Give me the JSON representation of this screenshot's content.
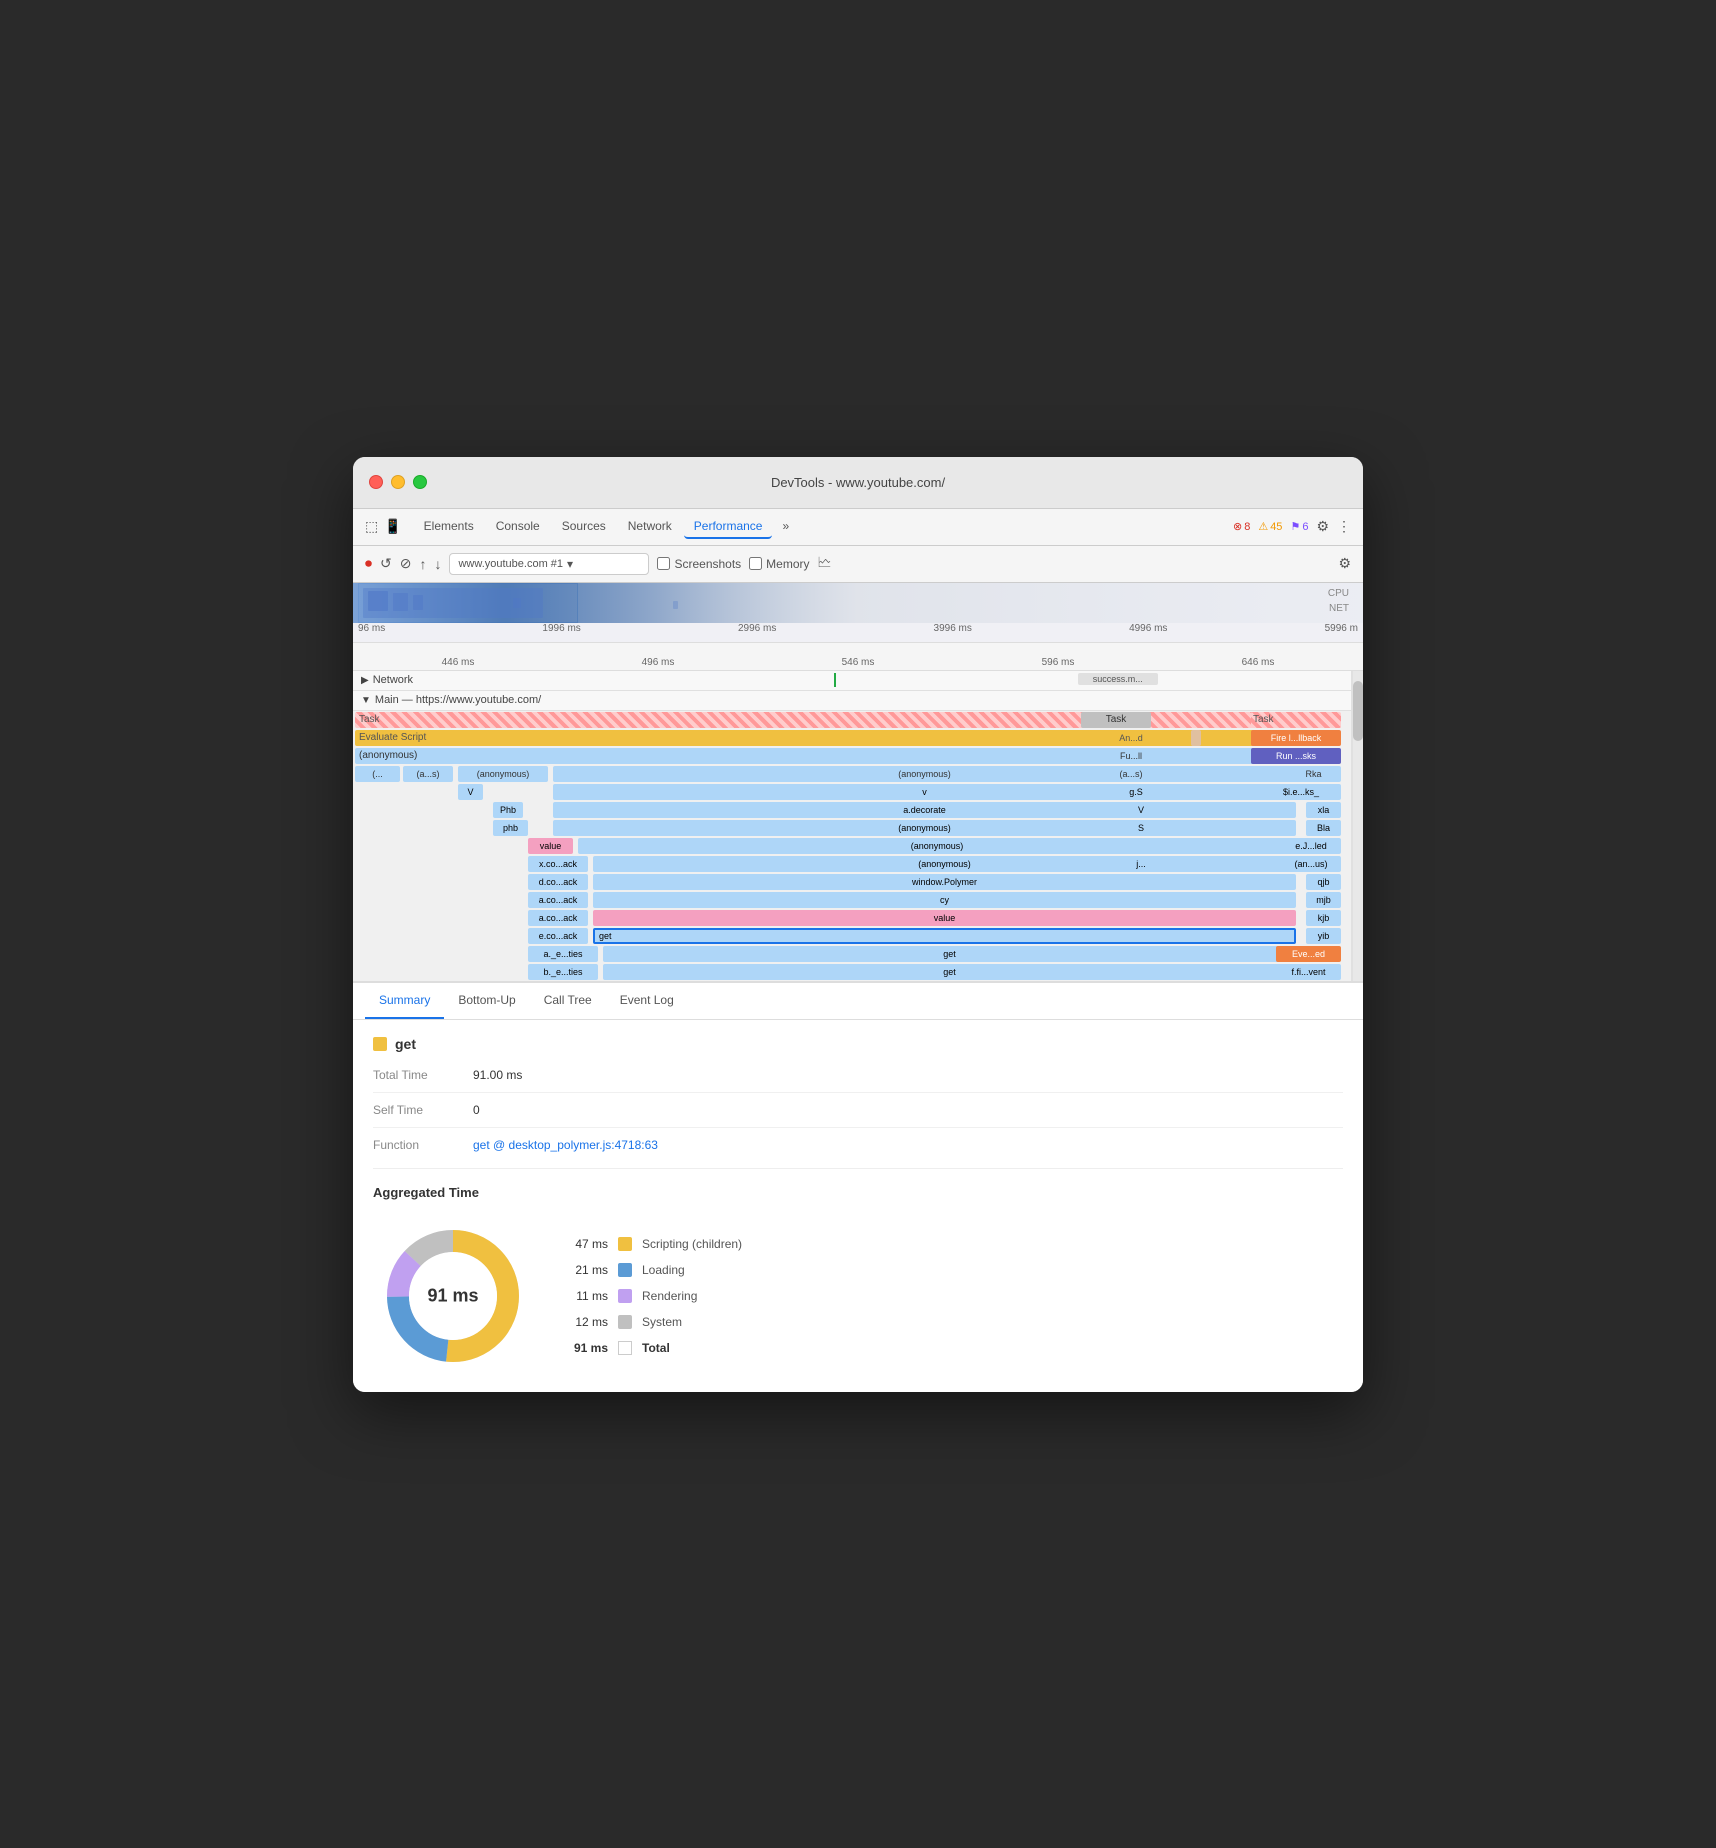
{
  "window": {
    "title": "DevTools - www.youtube.com/"
  },
  "titlebar": {
    "title": "DevTools - www.youtube.com/"
  },
  "tabs": {
    "items": [
      "Elements",
      "Console",
      "Sources",
      "Network",
      "Performance",
      "»"
    ],
    "active": "Performance"
  },
  "badges": {
    "errors": "8",
    "warnings": "45",
    "purple": "6"
  },
  "toolbar2": {
    "url": "www.youtube.com #1",
    "screenshots_label": "Screenshots",
    "memory_label": "Memory"
  },
  "minimap": {
    "labels": [
      "96 ms",
      "1996 ms",
      "2996 ms",
      "3996 ms",
      "4996 ms",
      "5996 m"
    ]
  },
  "timeline": {
    "labels": [
      "446 ms",
      "496 ms",
      "546 ms",
      "596 ms",
      "646 ms"
    ],
    "network_label": "Network",
    "main_label": "Main — https://www.youtube.com/",
    "success_badge": "success.m..."
  },
  "flamechart": {
    "rows": [
      {
        "label": "Task",
        "right_labels": [
          "Task",
          "Task"
        ],
        "type": "task"
      },
      {
        "label": "Evaluate Script",
        "right_labels": [
          "An...d",
          "Fire l...llback"
        ],
        "type": "evaluate"
      },
      {
        "label": "(anonymous)",
        "right_labels": [
          "Fu...ll",
          "Run ...sks"
        ],
        "type": "anonymous"
      },
      {
        "label": "(...",
        "sub": "(a...s)",
        "sub2": "(anonymous)",
        "sub3": "(anonymous)",
        "right": "(a...s)",
        "rr": "Rka"
      },
      {
        "label": "V",
        "sub": "v",
        "right": "g.S",
        "rr": "$i.e...ks_"
      },
      {
        "label": "Phb",
        "sub": "a.decorate",
        "right": "V",
        "rr": "xla"
      },
      {
        "label": "phb",
        "sub": "(anonymous)",
        "right": "S",
        "rr": "Bla"
      },
      {
        "label": "value",
        "sub": "(anonymous)",
        "rr": "e.J...led"
      },
      {
        "label": "x.co...ack",
        "sub": "(anonymous)",
        "right": "j...",
        "rr": "(an...us)"
      },
      {
        "label": "d.co...ack",
        "sub": "window.Polymer",
        "rr": "qjb"
      },
      {
        "label": "a.co...ack",
        "sub": "cy",
        "rr": "mjb"
      },
      {
        "label": "a.co...ack",
        "sub": "value",
        "rr": "kjb"
      },
      {
        "label": "e.co...ack",
        "sub": "get",
        "rr": "yib",
        "selected": true
      },
      {
        "label": "a._e...ties",
        "sub": "get",
        "rr": "Eve...ed"
      },
      {
        "label": "b._e...ties",
        "sub": "get",
        "rr": "f.fi...vent"
      }
    ]
  },
  "summary": {
    "tabs": [
      "Summary",
      "Bottom-Up",
      "Call Tree",
      "Event Log"
    ],
    "active_tab": "Summary",
    "function_name": "get",
    "total_time": "91.00 ms",
    "self_time": "0",
    "function_link": "get @ desktop_polymer.js:4718:63",
    "agg_title": "Aggregated Time",
    "donut_label": "91 ms",
    "legend": [
      {
        "ms": "47 ms",
        "color": "#f0c040",
        "label": "Scripting (children)"
      },
      {
        "ms": "21 ms",
        "color": "#5b9bd5",
        "label": "Loading"
      },
      {
        "ms": "11 ms",
        "color": "#c0a0f0",
        "label": "Rendering"
      },
      {
        "ms": "12 ms",
        "color": "#c0c0c0",
        "label": "System"
      },
      {
        "ms": "91 ms",
        "color": "white",
        "label": "Total",
        "bold": true
      }
    ]
  }
}
